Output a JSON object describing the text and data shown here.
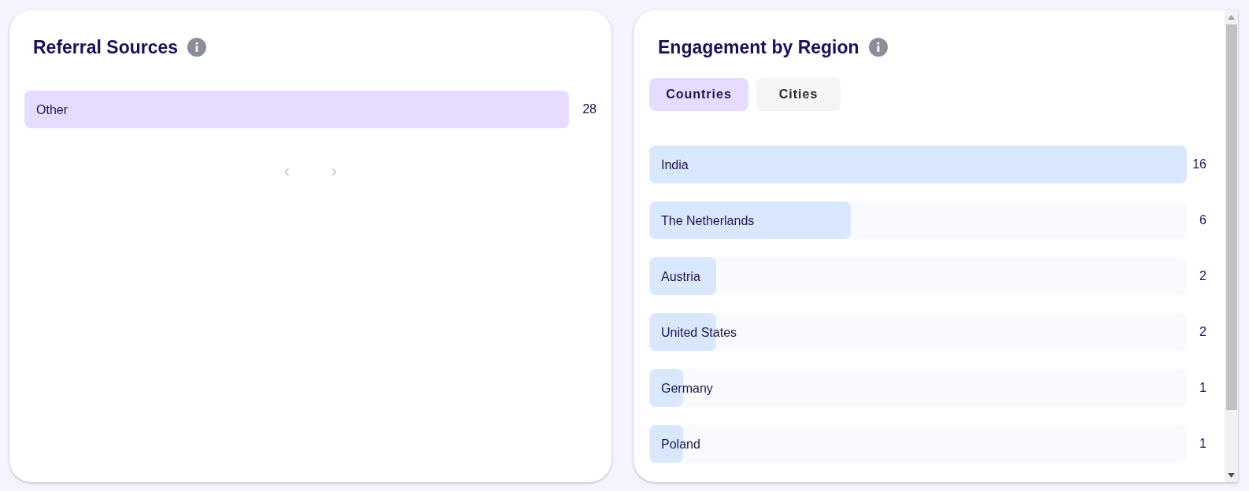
{
  "referral_sources": {
    "title": "Referral Sources",
    "rows": [
      {
        "label": "Other",
        "value": "28"
      }
    ],
    "pagination": {
      "prev": "‹",
      "next": "›"
    }
  },
  "engagement_by_region": {
    "title": "Engagement by Region",
    "tabs": [
      {
        "label": "Countries",
        "selected": true
      },
      {
        "label": "Cities",
        "selected": false
      }
    ],
    "rows": [
      {
        "label": "India",
        "level": 1,
        "value": "16"
      },
      {
        "label": "The Netherlands",
        "level": 0.375,
        "value": "6"
      },
      {
        "label": "Austria",
        "level": 0.125,
        "value": "2"
      },
      {
        "label": "United States",
        "level": 0.125,
        "value": "2"
      },
      {
        "label": "Germany",
        "level": 0.0625,
        "value": "1"
      },
      {
        "label": "Poland",
        "level": 0.0625,
        "value": "1"
      }
    ]
  }
}
